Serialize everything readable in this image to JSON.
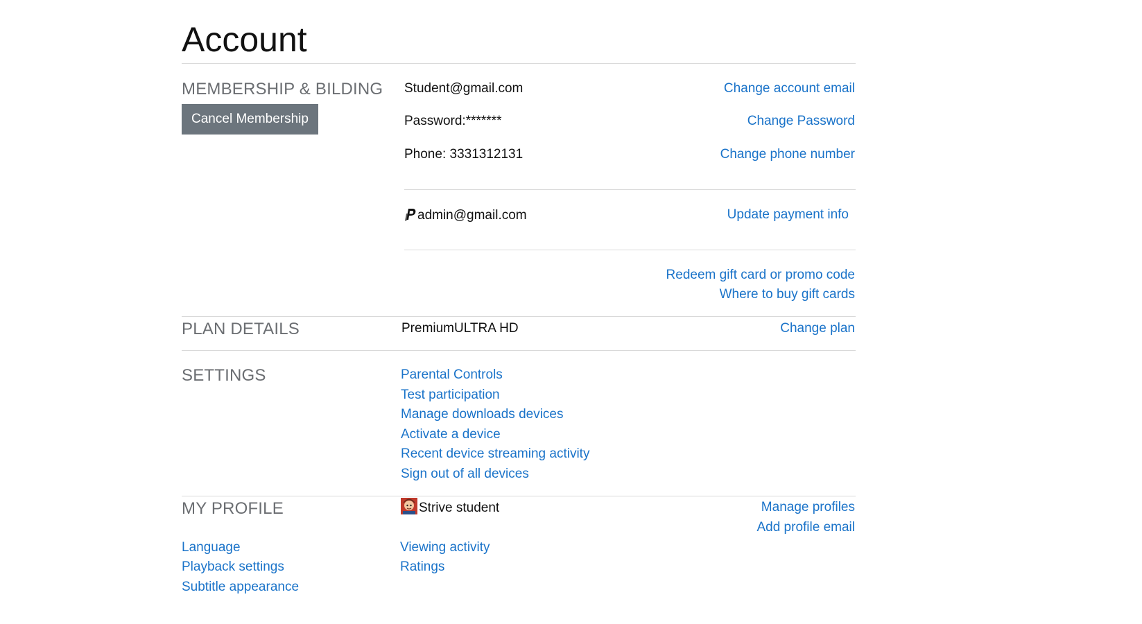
{
  "page": {
    "title": "Account"
  },
  "membership": {
    "section_title": "MEMBERSHIP & BILDING",
    "cancel_button": "Cancel Membership",
    "email": "Student@gmail.com",
    "change_email": "Change account email",
    "password": "Password:*******",
    "change_password": "Change Password",
    "phone": "Phone: 3331312131",
    "change_phone": "Change phone number",
    "payment_email": "admin@gmail.com",
    "payment_icon": "paypal-icon",
    "update_payment": "Update payment info",
    "redeem": "Redeem gift card or promo code",
    "where_to_buy": "Where to buy gift cards"
  },
  "plan": {
    "section_title": "PLAN DETAILS",
    "plan_name": "PremiumULTRA HD",
    "change_plan": "Change plan"
  },
  "settings": {
    "section_title": "SETTINGS",
    "links": [
      "Parental Controls",
      "Test participation",
      "Manage downloads devices",
      "Activate a device",
      "Recent device streaming activity",
      "Sign out of all devices"
    ]
  },
  "profile": {
    "section_title": "MY PROFILE",
    "profile_name": "Strive student",
    "avatar_icon": "avatar",
    "manage_profiles": "Manage profiles",
    "add_profile_email": "Add profile email",
    "left_links": [
      "Language",
      "Playback settings",
      "Subtitle appearance"
    ],
    "middle_links": [
      "Viewing activity",
      "Ratings"
    ]
  },
  "colors": {
    "link": "#1a73c9",
    "section_title": "#6b6e72",
    "button_bg": "#6c757d",
    "divider": "#d9d9d9"
  }
}
